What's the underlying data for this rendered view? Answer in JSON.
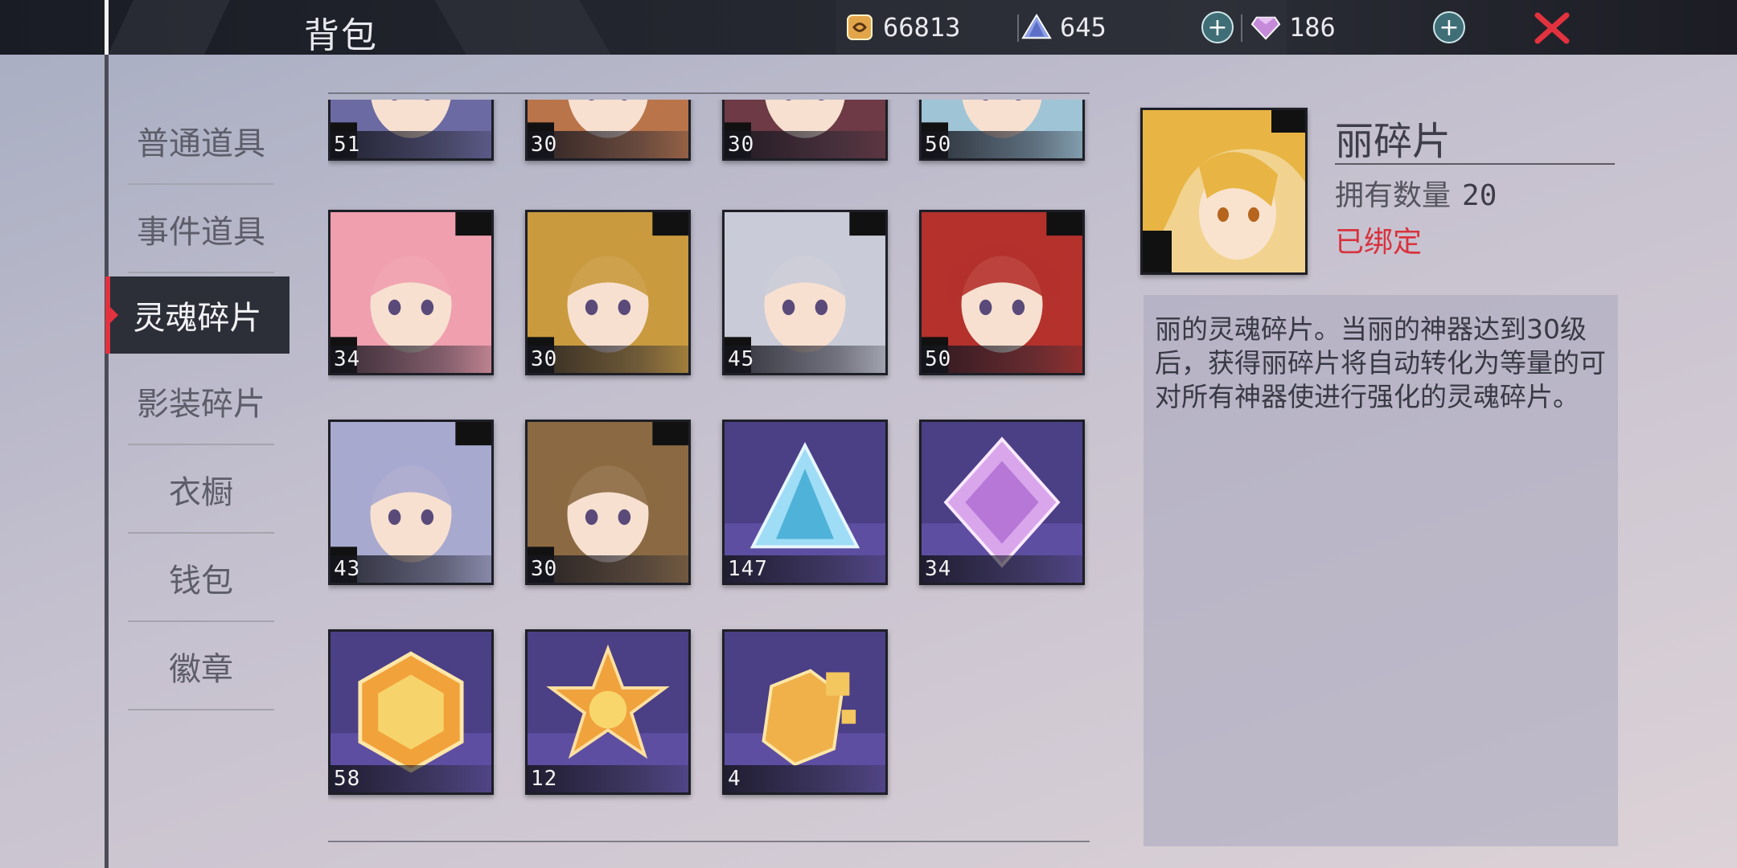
{
  "header": {
    "title": "背包"
  },
  "currencies": [
    {
      "icon": "gold-coin-icon",
      "value": "66813"
    },
    {
      "icon": "blue-pyramid-crystal-icon",
      "value": "645"
    },
    {
      "icon": "pink-diamond-icon",
      "value": "186"
    }
  ],
  "nav": {
    "items": [
      {
        "label": "普通道具"
      },
      {
        "label": "事件道具"
      },
      {
        "label": "灵魂碎片"
      },
      {
        "label": "影装碎片"
      },
      {
        "label": "衣橱"
      },
      {
        "label": "钱包"
      },
      {
        "label": "徽章"
      }
    ],
    "active_index": 2
  },
  "items": [
    {
      "count": "51",
      "art": "portrait-partial-dark-hair",
      "bg": "#6b6aa2"
    },
    {
      "count": "30",
      "art": "portrait-partial-orange-hair",
      "bg": "#b9744a"
    },
    {
      "count": "30",
      "art": "portrait-partial-dark-red",
      "bg": "#6d3a45"
    },
    {
      "count": "50",
      "art": "portrait-partial-white-hair",
      "bg": "#9fc4d6"
    },
    {
      "count": "34",
      "art": "portrait-pink-hair-girl",
      "bg": "#ef9fae"
    },
    {
      "count": "30",
      "art": "portrait-blonde-officer-cap",
      "bg": "#c99a3e"
    },
    {
      "count": "45",
      "art": "portrait-silver-hair-girl",
      "bg": "#c9ccd8"
    },
    {
      "count": "50",
      "art": "portrait-red-hair-sunglasses",
      "bg": "#b4312c"
    },
    {
      "count": "43",
      "art": "portrait-lavender-hair",
      "bg": "#a7a9cf"
    },
    {
      "count": "30",
      "art": "portrait-brown-hair-boy",
      "bg": "#8b6a43"
    },
    {
      "count": "147",
      "art": "blue-pyramid-crystal",
      "bg": "#4b3f86"
    },
    {
      "count": "34",
      "art": "pink-octahedron-crystal",
      "bg": "#4b3f86"
    },
    {
      "count": "58",
      "art": "gold-hexagon-crystal",
      "bg": "#4b3f86"
    },
    {
      "count": "12",
      "art": "gold-star-crystal",
      "bg": "#4b3f86"
    },
    {
      "count": "4",
      "art": "gold-broken-crystal",
      "bg": "#4b3f86"
    }
  ],
  "detail": {
    "name": "丽碎片",
    "qty_label": "拥有数量",
    "qty_value": "20",
    "bound": "已绑定",
    "description": "丽的灵魂碎片。当丽的神器达到30级后，获得丽碎片将自动转化为等量的可对所有神器使进行强化的灵魂碎片。"
  },
  "colors": {
    "accent_red": "#e3323f",
    "bound_red": "#d8323d",
    "panel": "#2d2f38"
  }
}
